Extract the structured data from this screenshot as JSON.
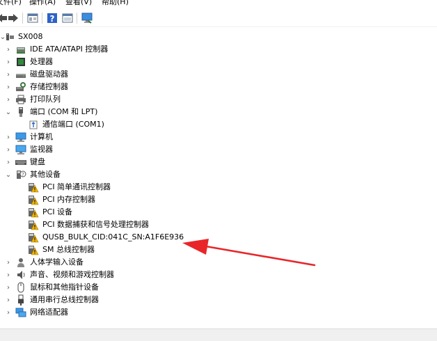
{
  "menu": {
    "file": "文件(F)",
    "action": "操作(A)",
    "view": "查看(V)",
    "help": "帮助(H)"
  },
  "toolbar": {
    "buttons": [
      "back-icon",
      "forward-icon",
      "properties-icon",
      "help-icon",
      "view-icon",
      "monitor-icon"
    ]
  },
  "tree": {
    "root": "SX008",
    "items": [
      {
        "label": "IDE ATA/ATAPI 控制器",
        "icon": "ide-controller-icon",
        "state": "collapsed"
      },
      {
        "label": "处理器",
        "icon": "processor-icon",
        "state": "collapsed"
      },
      {
        "label": "磁盘驱动器",
        "icon": "disk-drive-icon",
        "state": "collapsed"
      },
      {
        "label": "存储控制器",
        "icon": "storage-controller-icon",
        "state": "collapsed"
      },
      {
        "label": "打印队列",
        "icon": "printer-icon",
        "state": "collapsed"
      },
      {
        "label": "端口 (COM 和 LPT)",
        "icon": "port-icon",
        "state": "expanded",
        "children": [
          {
            "label": "通信端口 (COM1)",
            "icon": "comm-port-icon"
          }
        ]
      },
      {
        "label": "计算机",
        "icon": "computer-icon",
        "state": "collapsed"
      },
      {
        "label": "监视器",
        "icon": "monitor-icon",
        "state": "collapsed"
      },
      {
        "label": "键盘",
        "icon": "keyboard-icon",
        "state": "collapsed"
      },
      {
        "label": "其他设备",
        "icon": "other-devices-icon",
        "state": "expanded",
        "children": [
          {
            "label": "PCI 简单通讯控制器",
            "icon": "warning-device-icon"
          },
          {
            "label": "PCI 内存控制器",
            "icon": "warning-device-icon"
          },
          {
            "label": "PCI 设备",
            "icon": "warning-device-icon"
          },
          {
            "label": "PCI 数据捕获和信号处理控制器",
            "icon": "warning-device-icon"
          },
          {
            "label": "QUSB_BULK_CID:041C_SN:A1F6E936",
            "icon": "warning-device-icon"
          },
          {
            "label": "SM 总线控制器",
            "icon": "warning-device-icon"
          }
        ]
      },
      {
        "label": "人体学输入设备",
        "icon": "hid-icon",
        "state": "collapsed"
      },
      {
        "label": "声音、视频和游戏控制器",
        "icon": "sound-icon",
        "state": "collapsed"
      },
      {
        "label": "鼠标和其他指针设备",
        "icon": "mouse-icon",
        "state": "collapsed"
      },
      {
        "label": "通用串行总线控制器",
        "icon": "usb-icon",
        "state": "collapsed"
      },
      {
        "label": "网络适配器",
        "icon": "network-adapter-icon",
        "state": "collapsed"
      }
    ]
  },
  "annotation": {
    "color": "#e8262a",
    "target": "QUSB_BULK_CID:041C_SN:A1F6E936"
  }
}
